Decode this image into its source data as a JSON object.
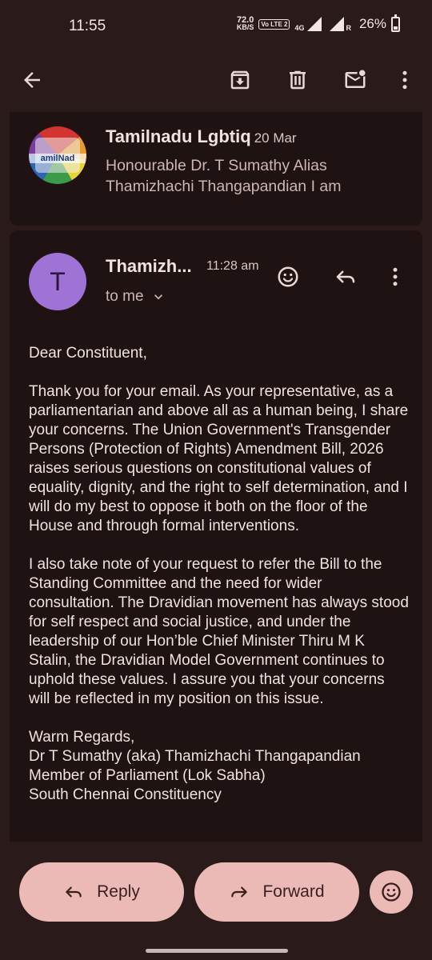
{
  "status_bar": {
    "time": "11:55",
    "net_speed_value": "72.0",
    "net_speed_unit": "KB/S",
    "volte": "Vo LTE 2",
    "network": "4G",
    "roaming": "R",
    "battery": "26%"
  },
  "toolbar": {
    "icons": [
      "back-arrow-icon",
      "archive-icon",
      "delete-icon",
      "mark-unread-icon",
      "more-vert-icon"
    ]
  },
  "previous_email": {
    "avatar_text": "amilNad",
    "sender": "Tamilnadu Lgbtiq",
    "date": "20 Mar",
    "snippet": "Honourable Dr. T Sumathy Alias Thamizhachi Thangapandian I am"
  },
  "open_email": {
    "avatar_letter": "T",
    "sender": "Thamizh...",
    "time": "11:28 am",
    "recipient": "to me",
    "body": {
      "greeting": "Dear Constituent,",
      "paragraph1": "Thank you for your email. As your representative, as a parliamentarian and above all as a human being, I share your concerns. The Union Government's Transgender Persons (Protection of Rights) Amendment Bill, 2026 raises serious questions on constitutional values of equality, dignity, and the right to self determination, and I will do my best to oppose it both on the floor of the House and through formal interventions.",
      "paragraph2": "I also take note of your request to refer the Bill to the Standing Committee and the need for wider consultation. The Dravidian movement has always stood for self respect and social justice, and under the leadership of our Hon’ble Chief Minister Thiru M K Stalin, the Dravidian Model Government continues to uphold these values. I assure you that your concerns will be reflected in my position on this issue.",
      "closing": "Warm Regards,",
      "sig_name": "Dr T Sumathy (aka) Thamizhachi Thangapandian",
      "sig_title": "Member of Parliament (Lok Sabha)",
      "sig_constituency": "South Chennai Constituency"
    }
  },
  "actions": {
    "reply_label": "Reply",
    "forward_label": "Forward"
  },
  "colors": {
    "background": "#2b1a1a",
    "card": "#1f1212",
    "button": "#ebbab6",
    "avatar": "#9f73d6"
  }
}
